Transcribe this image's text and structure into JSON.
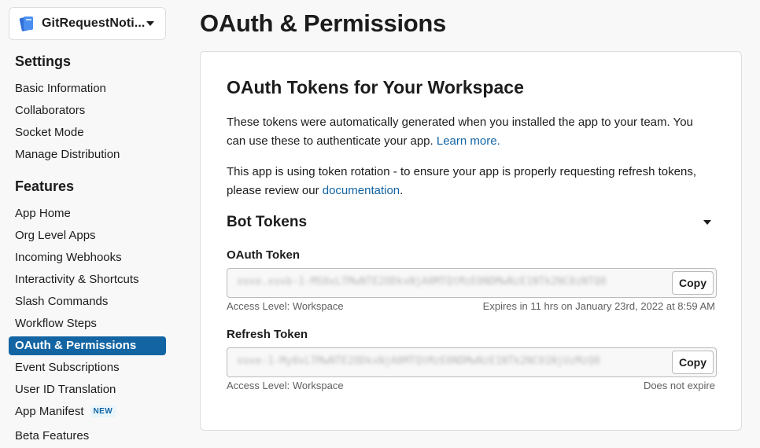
{
  "sidebar": {
    "app_name": "GitRequestNoti...",
    "settings_title": "Settings",
    "settings_items": [
      "Basic Information",
      "Collaborators",
      "Socket Mode",
      "Manage Distribution"
    ],
    "features_title": "Features",
    "features_items": [
      {
        "label": "App Home"
      },
      {
        "label": "Org Level Apps"
      },
      {
        "label": "Incoming Webhooks"
      },
      {
        "label": "Interactivity & Shortcuts"
      },
      {
        "label": "Slash Commands"
      },
      {
        "label": "Workflow Steps"
      },
      {
        "label": "OAuth & Permissions",
        "active": true
      },
      {
        "label": "Event Subscriptions"
      },
      {
        "label": "User ID Translation"
      },
      {
        "label": "App Manifest",
        "badge": "NEW"
      },
      {
        "label": "Beta Features"
      }
    ]
  },
  "page": {
    "title": "OAuth & Permissions"
  },
  "card": {
    "title": "OAuth Tokens for Your Workspace",
    "para1_text": "These tokens were automatically generated when you installed the app to your team. You can use these to authenticate your app.",
    "para1_link": "Learn more.",
    "para2_text": "This app is using token rotation - to ensure your app is properly requesting refresh tokens, please review our",
    "para2_link": "documentation",
    "para2_end": ".",
    "bot_tokens_title": "Bot Tokens",
    "oauth_token": {
      "label": "OAuth Token",
      "value": "xoxe.xoxb-1-MS0xLTMwNTE2ODkxNjA0MTQtMzE0NDMwNzE1NTk2NC0zNTQ0",
      "copy_label": "Copy",
      "access_level": "Access Level: Workspace",
      "expiry": "Expires in 11 hrs on January 23rd, 2022 at 8:59 AM"
    },
    "refresh_token": {
      "label": "Refresh Token",
      "value": "xoxe-1-My0xLTMwNTE2ODkxNjA0MTQtMzE0NDMwNzE1NTk2NC01NjUzMzQ0",
      "copy_label": "Copy",
      "access_level": "Access Level: Workspace",
      "expiry": "Does not expire"
    }
  },
  "colors": {
    "accent": "#1264a3",
    "text": "#1d1c1d",
    "muted": "#616061",
    "background": "#f8f8f8"
  }
}
